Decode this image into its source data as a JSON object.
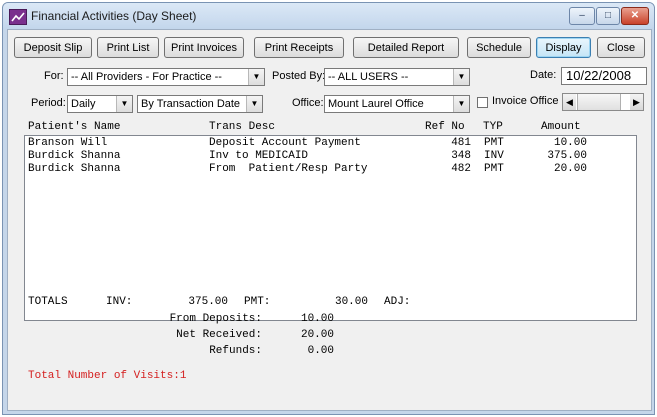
{
  "window": {
    "title": "Financial Activities (Day Sheet)",
    "controls": {
      "minimize": "–",
      "maximize": "□",
      "close": "✕"
    }
  },
  "toolbar": {
    "deposit_slip": "Deposit Slip",
    "print_list": "Print List",
    "print_invoices": "Print Invoices",
    "print_receipts": "Print Receipts",
    "detailed_report": "Detailed Report",
    "schedule": "Schedule",
    "display": "Display",
    "close": "Close"
  },
  "filters": {
    "for_label": "For:",
    "for_value": "-- All Providers - For Practice --",
    "posted_by_label": "Posted By:",
    "posted_by_value": "-- ALL USERS --",
    "date_label": "Date:",
    "date_value": "10/22/2008",
    "period_label": "Period:",
    "period_value": "Daily",
    "by_value": "By Transaction Date",
    "office_label": "Office:",
    "office_value": "Mount Laurel Office",
    "invoice_office_label": "Invoice Office",
    "invoice_office_checked": false
  },
  "table": {
    "columns": [
      "Patient's Name",
      "Trans Desc",
      "Ref No",
      "TYP",
      "Amount"
    ],
    "rows": [
      {
        "name": "Branson Will",
        "desc": "Deposit Account Payment",
        "ref": "481",
        "typ": "PMT",
        "amount": "10.00"
      },
      {
        "name": "Burdick Shanna",
        "desc": "Inv to MEDICAID",
        "ref": "348",
        "typ": "INV",
        "amount": "375.00"
      },
      {
        "name": "Burdick Shanna",
        "desc": "From  Patient/Resp Party",
        "ref": "482",
        "typ": "PMT",
        "amount": "20.00"
      }
    ]
  },
  "totals": {
    "label": "TOTALS",
    "inv_label": "INV:",
    "inv_value": "375.00",
    "pmt_label": "PMT:",
    "pmt_value": "30.00",
    "adj_label": "ADJ:",
    "from_deposits_label": "From Deposits:",
    "from_deposits_value": "10.00",
    "net_received_label": "Net Received:",
    "net_received_value": "20.00",
    "refunds_label": "Refunds:",
    "refunds_value": "0.00",
    "visits": "Total Number of Visits:1"
  },
  "icons": {
    "app": "chart-line-icon",
    "combo_arrow": "chevron-down-icon",
    "scroll_left": "arrow-left-icon",
    "scroll_right": "arrow-right-icon"
  },
  "colors": {
    "accent_red": "#d42020",
    "title_bar": "#c5d6ea"
  }
}
